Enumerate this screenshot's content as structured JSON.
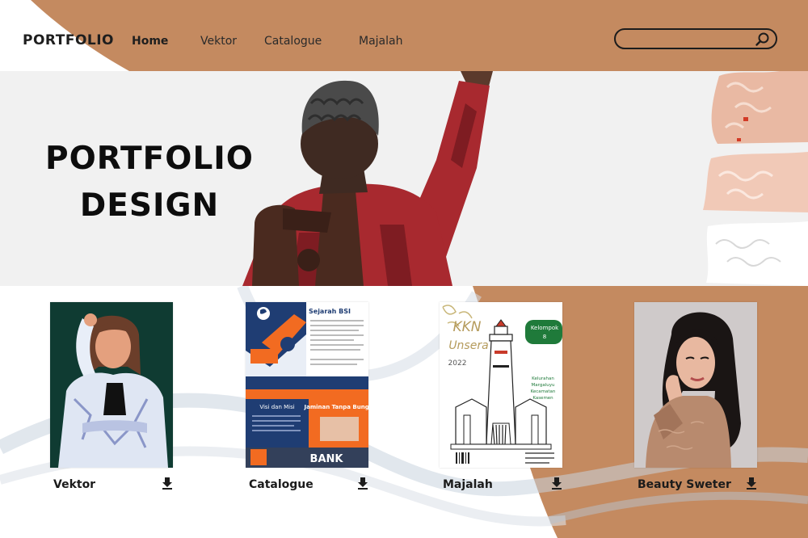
{
  "header": {
    "logo": "PORTFOLIO",
    "nav": [
      {
        "label": "Home",
        "active": true
      },
      {
        "label": "Vektor",
        "active": false
      },
      {
        "label": "Catalogue",
        "active": false
      },
      {
        "label": "Majalah",
        "active": false
      }
    ],
    "search": {
      "value": "",
      "placeholder": "",
      "icon": "search-icon"
    }
  },
  "hero": {
    "title_line1": "PORTFOLIO",
    "title_line2": "DESIGN"
  },
  "cards": [
    {
      "label": "Vektor",
      "icon": "download-icon"
    },
    {
      "label": "Catalogue",
      "icon": "download-icon"
    },
    {
      "label": "Majalah",
      "icon": "download-icon"
    },
    {
      "label": "Beauty Sweter",
      "icon": "download-icon"
    }
  ],
  "thumbs": {
    "catalogue": {
      "heading": "Sejarah BSI",
      "section1": "Visi dan Misi",
      "section2": "Jaminan Tanpa Bunga",
      "sign": "BANK"
    },
    "majalah": {
      "badge_line1": "Kelompok",
      "badge_line2": "8",
      "title_line1": "KKN",
      "title_line2": "Unsera",
      "year": "2022",
      "text_line1": "Kelurahan",
      "text_line2": "Margaluyu",
      "text_line3": "Kecamatan",
      "text_line4": "Kasemen"
    }
  },
  "colors": {
    "tan": "#c48a60",
    "hero_bg": "#f1f1f1",
    "dark": "#1c1c1c"
  }
}
